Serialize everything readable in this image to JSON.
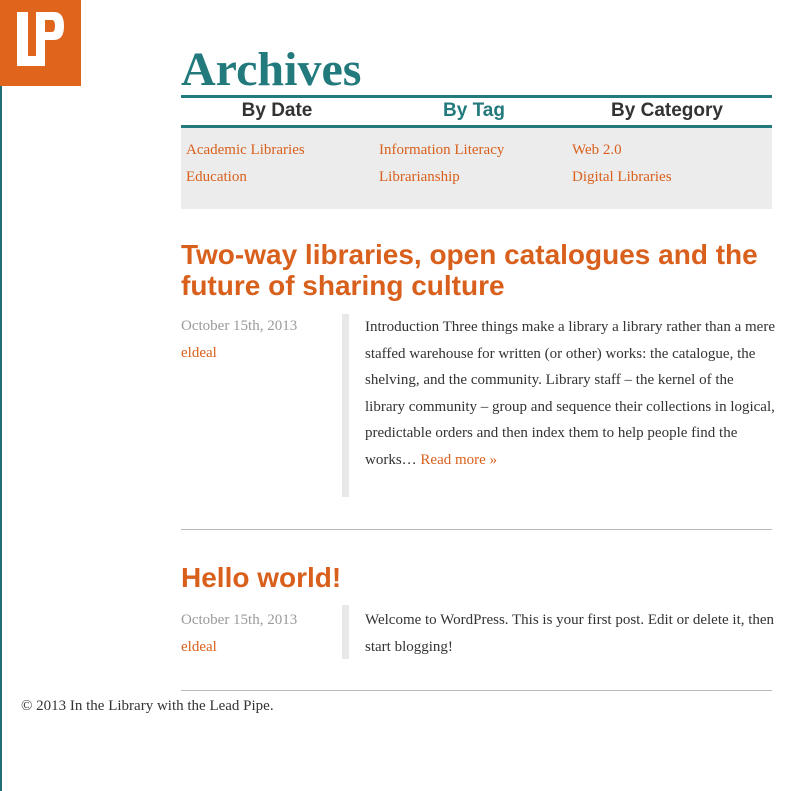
{
  "logo": {
    "text": "LP",
    "background": "#e0651c"
  },
  "page": {
    "title": "Archives"
  },
  "tabs": [
    {
      "label": "By Date",
      "active": false
    },
    {
      "label": "By Tag",
      "active": true
    },
    {
      "label": "By Category",
      "active": false
    }
  ],
  "tags": {
    "col1": [
      "Academic Libraries",
      "Education"
    ],
    "col2": [
      "Information Literacy",
      "Librarianship"
    ],
    "col3": [
      "Web 2.0",
      "Digital Libraries"
    ]
  },
  "posts": [
    {
      "title": "Two-way libraries, open catalogues and the future of sharing culture",
      "date": "October 15th, 2013",
      "author": "eldeal",
      "excerpt": "Introduction Three things make a library a library rather than a mere staffed warehouse for written (or other) works: the catalogue, the shelving, and the community. Library staff – the kernel of the library community – group and sequence their collections in logical, predictable orders and then index them to help people find the works… ",
      "read_more": "Read more »"
    },
    {
      "title": "Hello world!",
      "date": "October 15th, 2013",
      "author": "eldeal",
      "excerpt": "Welcome to WordPress. This is your first post. Edit or delete it, then start blogging!"
    }
  ],
  "footer": {
    "text": "© 2013 In the Library with the Lead Pipe."
  },
  "colors": {
    "accent": "#227a7c",
    "link": "#d9601c",
    "panel": "#ececec",
    "meta": "#9a9a9a"
  }
}
